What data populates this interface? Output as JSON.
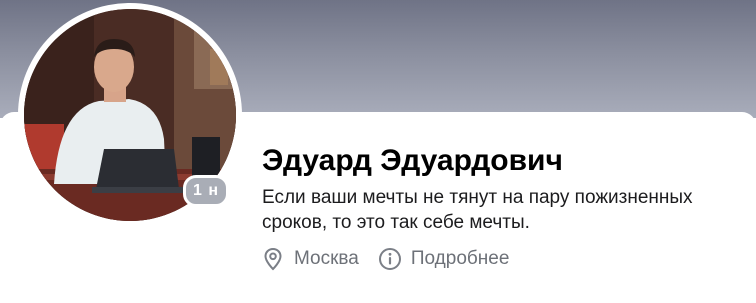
{
  "profile": {
    "name": "Эдуард Эдуардович",
    "status": "Если ваши мечты не тянут на пару пожизненных сроков, то это так себе мечты.",
    "online_badge": "1 н",
    "location": "Москва",
    "details_label": "Подробнее"
  },
  "icons": {
    "location": "location-pin-icon",
    "info": "info-circle-icon"
  },
  "colors": {
    "cover": "#8b8f9f",
    "badge": "#a9adb6",
    "meta_text": "#6d7178"
  }
}
